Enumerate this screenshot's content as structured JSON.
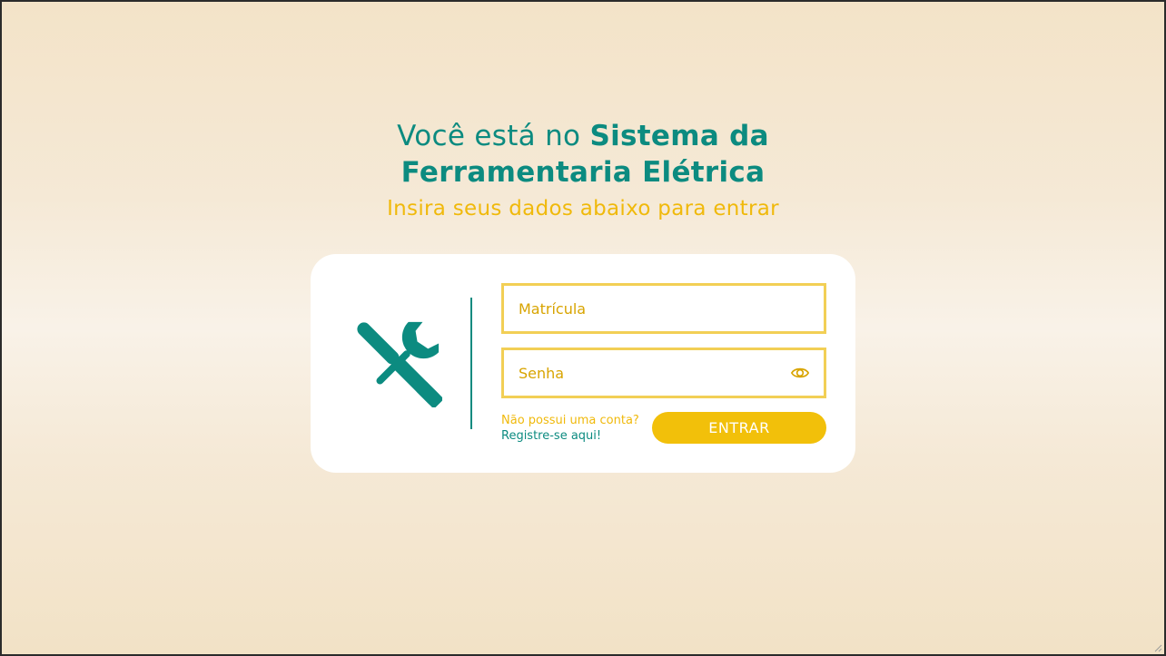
{
  "header": {
    "title_prefix": "Você está no ",
    "title_bold": "Sistema da Ferramentaria Elétrica",
    "subtitle": "Insira seus dados abaixo para entrar"
  },
  "login_form": {
    "matricula_placeholder": "Matrícula",
    "matricula_value": "",
    "senha_placeholder": "Senha",
    "senha_value": "",
    "register_question": "Não possui uma conta?",
    "register_link": "Registre-se aqui!",
    "submit_label": "ENTRAR"
  },
  "icons": {
    "logo": "tools-icon",
    "password_toggle": "eye-icon"
  },
  "colors": {
    "primary": "#0c8b80",
    "accent": "#f2c00a",
    "field_border": "#f2cf55",
    "background": "#f5e9d6"
  }
}
